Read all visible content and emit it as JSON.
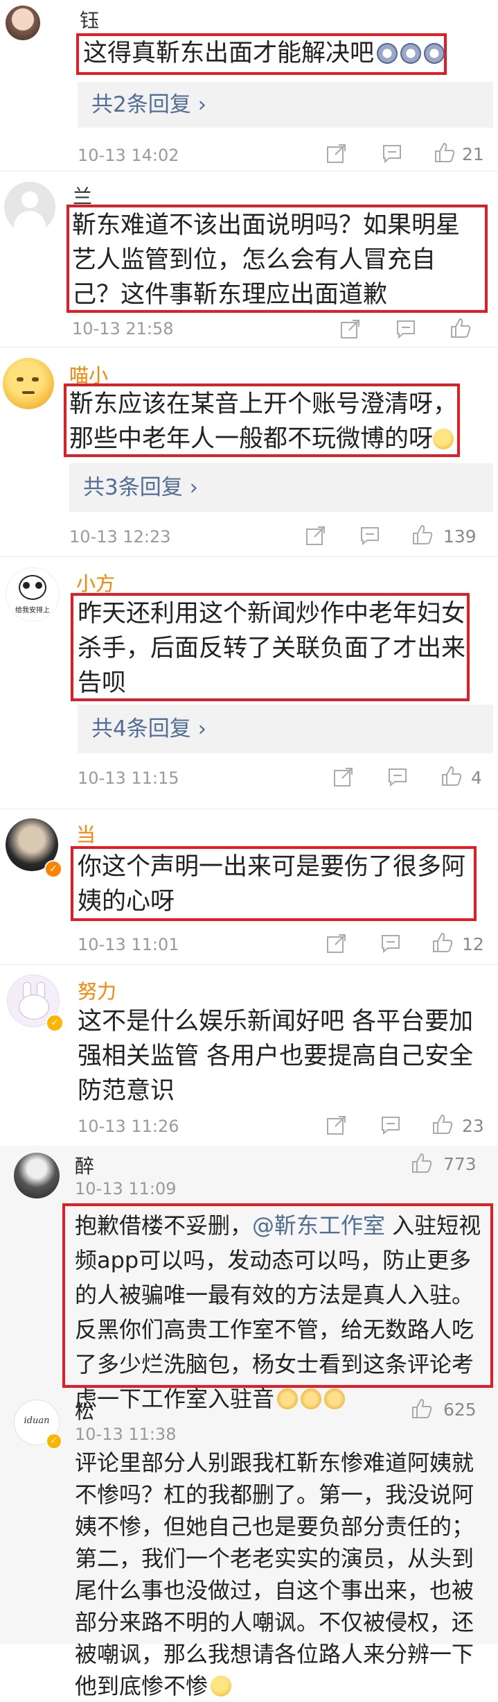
{
  "comments": [
    {
      "name": "钰",
      "text": "这得真靳东出面才能解决吧",
      "replies": "共2条回复 ›",
      "time": "10-13 14:02",
      "likes": "21"
    },
    {
      "name": "兰",
      "text": "靳东难道不该出面说明吗？如果明星艺人监管到位，怎么会有人冒充自己？这件事靳东理应出面道歉",
      "time": "10-13 21:58",
      "likes": ""
    },
    {
      "name": "喵小",
      "text": "靳东应该在某音上开个账号澄清呀，那些中老年人一般都不玩微博的呀",
      "replies": "共3条回复 ›",
      "time": "10-13 12:23",
      "likes": "139"
    },
    {
      "name": "小方",
      "avatar_caption": "给我安排上",
      "text": "昨天还利用这个新闻炒作中老年妇女杀手，后面反转了关联负面了才出来告呗",
      "replies": "共4条回复 ›",
      "time": "10-13 11:15",
      "likes": "4"
    },
    {
      "name": "当",
      "text": "你这个声明一出来可是要伤了很多阿姨的心呀",
      "time": "10-13 11:01",
      "likes": "12"
    },
    {
      "name": "努力",
      "text": "这不是什么娱乐新闻好吧 各平台要加强相关监管 各用户也要提高自己安全防范意识",
      "time": "10-13 11:26",
      "likes": "23"
    },
    {
      "name": "醉",
      "time": "10-13 11:09",
      "likes": "773",
      "mention": "@靳东工作室",
      "text_a": "抱歉借楼不妥删，",
      "text_b": " 入驻短视频app可以吗，发动态可以吗，防止更多的人被骗唯一最有效的方法是真人入驻。反黑你们高贵工作室不管，给无数路人吃了多少烂洗脑包，杨女士看到这条评论考虑一下工作室入驻",
      "text_c": "音"
    },
    {
      "name": "松",
      "avatar_caption": "iduan",
      "time": "10-13 11:38",
      "likes": "625",
      "text": "评论里部分人别跟我杠靳东惨难道阿姨就不惨吗？杠的我都删了。第一，我没说阿姨不惨，但她自己也是要负部分责任的；第二，我们一个老老实实的演员，从头到尾什么事也没做过，自这个事出来，也被部分来路不明的人嘲讽。不仅被侵权，还被嘲讽，那么我想请各位路人来分辨一下他到底惨不惨"
    }
  ],
  "icons": [
    "share-icon",
    "comment-icon",
    "like-icon",
    "verified-badge-icon",
    "emoji-icon"
  ],
  "colors": {
    "highlight_box": "#e51c23",
    "username_orange": "#ff8200",
    "link": "#526e94",
    "meta": "#9a9a9a"
  }
}
